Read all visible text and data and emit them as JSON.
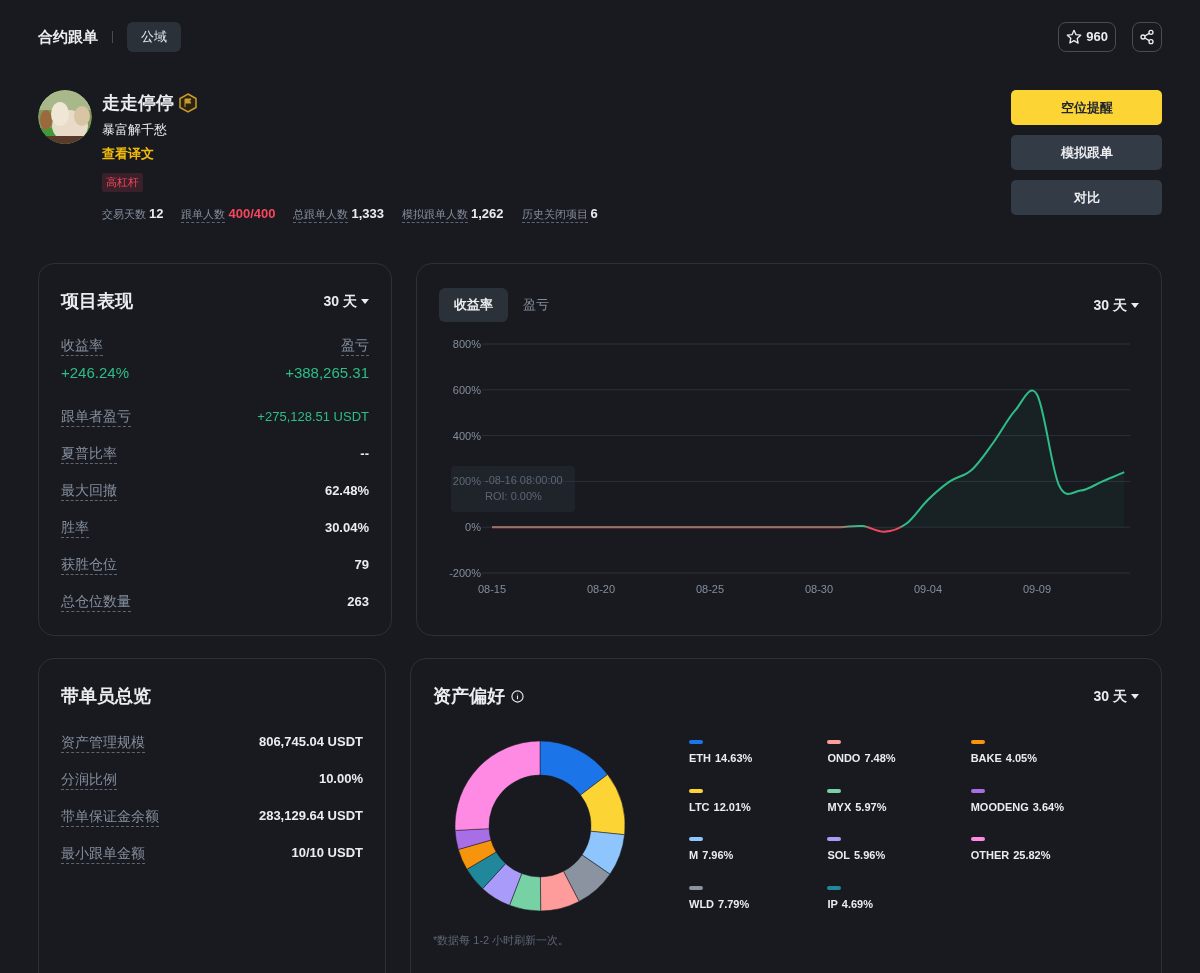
{
  "header": {
    "title": "合约跟单",
    "tabs": [
      {
        "label": "公域",
        "selected": true
      }
    ],
    "favorites": "960"
  },
  "profile": {
    "name": "走走停停",
    "bio": "暴富解千愁",
    "translate_link": "查看译文",
    "tags": [
      "高杠杆"
    ],
    "stats": [
      {
        "label": "交易天数",
        "value": "12",
        "highlight": false
      },
      {
        "label": "跟单人数",
        "value": "400/400",
        "highlight": true
      },
      {
        "label": "总跟单人数",
        "value": "1,333",
        "highlight": false
      },
      {
        "label": "模拟跟单人数",
        "value": "1,262",
        "highlight": false
      },
      {
        "label": "历史关闭项目",
        "value": "6",
        "highlight": false
      }
    ]
  },
  "actions": [
    {
      "label": "空位提醒",
      "kind": "primary"
    },
    {
      "label": "模拟跟单",
      "kind": "secondary"
    },
    {
      "label": "对比",
      "kind": "secondary"
    }
  ],
  "performance": {
    "title": "项目表现",
    "period": "30 天",
    "roi_label": "收益率",
    "roi": "+246.24%",
    "pnl_label": "盈亏",
    "pnl": "+388,265.31",
    "rows": [
      {
        "label": "跟单者盈亏",
        "value": "+275,128.51 USDT",
        "positive": true
      },
      {
        "label": "夏普比率",
        "value": "--",
        "positive": false
      },
      {
        "label": "最大回撤",
        "value": "62.48%",
        "positive": false
      },
      {
        "label": "胜率",
        "value": "30.04%",
        "positive": false
      },
      {
        "label": "获胜仓位",
        "value": "79",
        "positive": false
      },
      {
        "label": "总仓位数量",
        "value": "263",
        "positive": false
      }
    ]
  },
  "roi_chart": {
    "tabs": [
      {
        "label": "收益率",
        "selected": true
      },
      {
        "label": "盈亏",
        "selected": false
      }
    ],
    "period": "30 天",
    "tooltip": {
      "date": "-08-16 08:00:00",
      "value": "ROI: 0.00%"
    },
    "chart_data": {
      "type": "area",
      "grid": true,
      "categories": [
        "08-15",
        null,
        null,
        null,
        null,
        "08-20",
        null,
        null,
        null,
        null,
        "08-25",
        null,
        null,
        null,
        null,
        "08-30",
        null,
        null,
        null,
        null,
        "09-04",
        null,
        null,
        null,
        null,
        "09-09",
        null,
        null,
        null,
        null
      ],
      "series": [
        {
          "color": "#2ebd85",
          "values": [
            0,
            0,
            0,
            0,
            0,
            0,
            0,
            0,
            0,
            0,
            0,
            0,
            0,
            0,
            0,
            0,
            0,
            5,
            -20,
            15,
            120,
            200,
            250,
            370,
            510,
            580,
            185,
            160,
            200,
            240
          ]
        }
      ],
      "ylim": [
        -200,
        800
      ],
      "yticks": [
        {
          "value": -200,
          "label": "-200%"
        },
        {
          "value": 0,
          "label": "0%"
        },
        {
          "value": 200,
          "label": "200%"
        },
        {
          "value": 400,
          "label": "400%"
        },
        {
          "value": 600,
          "label": "600%"
        },
        {
          "value": 800,
          "label": "800%"
        }
      ]
    }
  },
  "lead_overview": {
    "title": "带单员总览",
    "rows": [
      {
        "label": "资产管理规模",
        "value": "806,745.04 USDT"
      },
      {
        "label": "分润比例",
        "value": "10.00%"
      },
      {
        "label": "带单保证金余额",
        "value": "283,129.64 USDT"
      },
      {
        "label": "最小跟单金额",
        "value": "10/10 USDT"
      }
    ]
  },
  "asset_preference": {
    "title": "资产偏好",
    "period": "30 天",
    "note": "*数据每 1-2 小时刷新一次。",
    "legend": [
      {
        "share": "14.63%",
        "color": "#1c75e8"
      },
      {
        "share": "12.01%",
        "color": "#fcd535"
      },
      {
        "share": "7.96%",
        "color": "#8ec5fc"
      },
      {
        "share": "7.79%",
        "color": "#8a939f"
      },
      {
        "share": "7.48%",
        "color": "#fe9b9b"
      },
      {
        "share": "5.97%",
        "color": "#76d2a4"
      },
      {
        "share": "5.96%",
        "color": "#a99bfa"
      },
      {
        "share": "4.69%",
        "color": "#21889c"
      },
      {
        "share": "4.05%",
        "color": "#f7940e"
      },
      {
        "share": "3.64%",
        "color": "#a86ee6"
      },
      {
        "share": "25.82%",
        "color": "#ff8ae3"
      }
    ],
    "chart_data": {
      "type": "donut",
      "categories": [
        "ETH",
        "LTC",
        "M",
        "WLD",
        "ONDO",
        "MYX",
        "SOL",
        "IP",
        "BAKE",
        "MOODENG",
        "OTHER"
      ],
      "values": [
        14.63,
        12.01,
        7.96,
        7.79,
        7.48,
        5.97,
        5.96,
        4.69,
        4.05,
        3.64,
        25.82
      ]
    }
  }
}
